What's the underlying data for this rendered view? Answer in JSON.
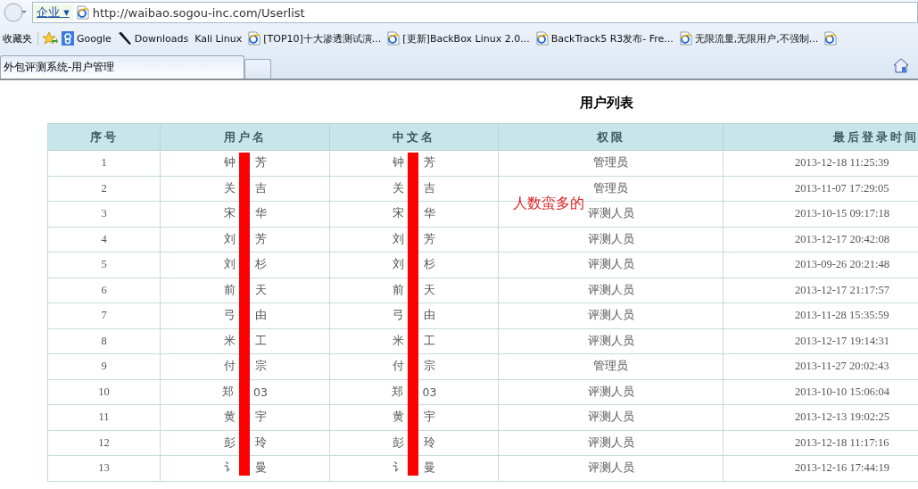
{
  "browser": {
    "address_menu": "企业",
    "address_menu_caret": "▾",
    "url": "http://waibao.sogou-inc.com/Userlist"
  },
  "favorites": {
    "label": "收藏夹",
    "items": [
      {
        "kind": "google",
        "label": "Google"
      },
      {
        "kind": "tool",
        "label": "Downloads"
      },
      {
        "kind": "plain",
        "label": "Kali Linux"
      },
      {
        "kind": "page",
        "label": "[TOP10]十大渗透测试演..."
      },
      {
        "kind": "page",
        "label": "[更新]BackBox Linux 2.0..."
      },
      {
        "kind": "page",
        "label": "BackTrack5 R3发布- Fre..."
      },
      {
        "kind": "page",
        "label": "无限流量,无限用户,不强制..."
      },
      {
        "kind": "page"
      }
    ]
  },
  "tabs": [
    {
      "label": "外包评测系统-用户管理",
      "selected": true
    },
    {
      "selected": false
    }
  ],
  "page": {
    "title": "用户列表",
    "annotation": "人数蛮多的",
    "table": {
      "columns": [
        "序号",
        "用户名",
        "中文名",
        "权限",
        "最后登录时间"
      ],
      "rows": [
        {
          "index": "1",
          "username": [
            "钟",
            "芳"
          ],
          "chinese_name": [
            "钟",
            "芳"
          ],
          "role": "管理员",
          "last_login": "2013-12-18 11:25:39"
        },
        {
          "index": "2",
          "username": [
            "关",
            "吉"
          ],
          "chinese_name": [
            "关",
            "吉"
          ],
          "role": "管理员",
          "last_login": "2013-11-07 17:29:05"
        },
        {
          "index": "3",
          "username": [
            "宋",
            "华"
          ],
          "chinese_name": [
            "宋",
            "华"
          ],
          "role": "评测人员",
          "last_login": "2013-10-15 09:17:18"
        },
        {
          "index": "4",
          "username": [
            "刘",
            "芳"
          ],
          "chinese_name": [
            "刘",
            "芳"
          ],
          "role": "评测人员",
          "last_login": "2013-12-17 20:42:08"
        },
        {
          "index": "5",
          "username": [
            "刘",
            "杉"
          ],
          "chinese_name": [
            "刘",
            "杉"
          ],
          "role": "评测人员",
          "last_login": "2013-09-26 20:21:48"
        },
        {
          "index": "6",
          "username": [
            "前",
            "天"
          ],
          "chinese_name": [
            "前",
            "天"
          ],
          "role": "评测人员",
          "last_login": "2013-12-17 21:17:57"
        },
        {
          "index": "7",
          "username": [
            "弓",
            "由"
          ],
          "chinese_name": [
            "弓",
            "由"
          ],
          "role": "评测人员",
          "last_login": "2013-11-28 15:35:59"
        },
        {
          "index": "8",
          "username": [
            "米",
            "工"
          ],
          "chinese_name": [
            "米",
            "工"
          ],
          "role": "评测人员",
          "last_login": "2013-12-17 19:14:31"
        },
        {
          "index": "9",
          "username": [
            "付",
            "宗"
          ],
          "chinese_name": [
            "付",
            "宗"
          ],
          "role": "管理员",
          "last_login": "2013-11-27 20:02:43"
        },
        {
          "index": "10",
          "username": [
            "郑",
            "03"
          ],
          "chinese_name": [
            "郑",
            "03"
          ],
          "role": "评测人员",
          "last_login": "2013-10-10 15:06:04"
        },
        {
          "index": "11",
          "username": [
            "黄",
            "宇"
          ],
          "chinese_name": [
            "黄",
            "宇"
          ],
          "role": "评测人员",
          "last_login": "2013-12-13 19:02:25"
        },
        {
          "index": "12",
          "username": [
            "彭",
            "玲"
          ],
          "chinese_name": [
            "彭",
            "玲"
          ],
          "role": "评测人员",
          "last_login": "2013-12-18 11:17:16"
        },
        {
          "index": "13",
          "username": [
            "讠",
            "曼"
          ],
          "chinese_name": [
            "讠",
            "曼"
          ],
          "role": "评测人员",
          "last_login": "2013-12-16 17:44:19"
        }
      ]
    }
  }
}
